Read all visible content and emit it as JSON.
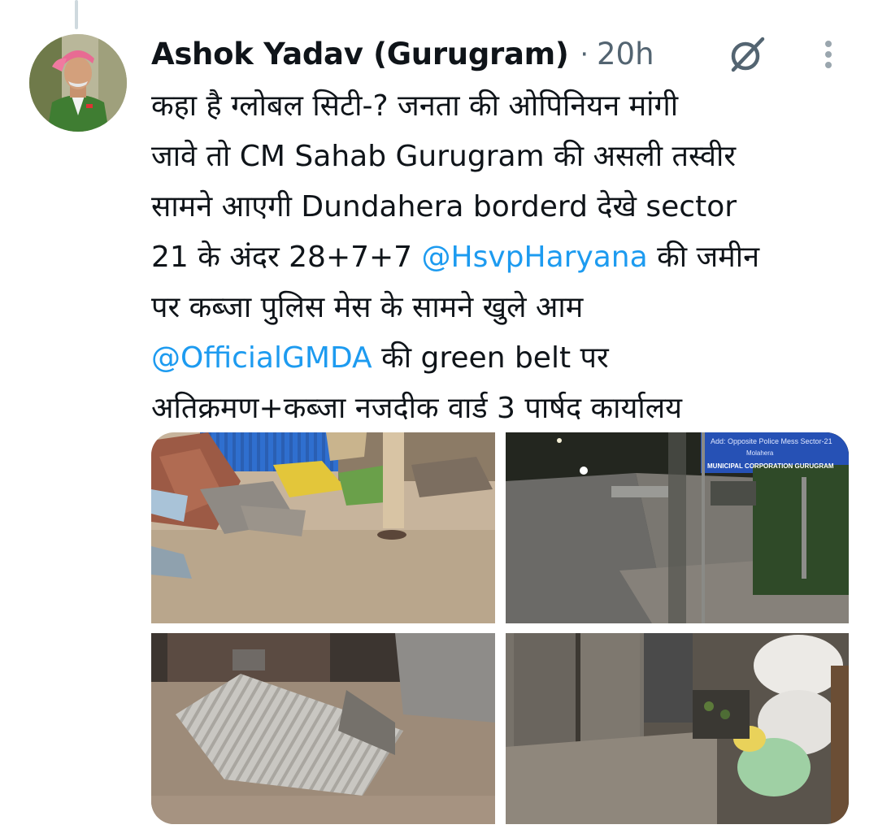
{
  "author": {
    "name": "Ashok Yadav (Gurugram)",
    "separator": "·",
    "time": "20h"
  },
  "icons": {
    "grok": "grok-icon",
    "more": "more-options-icon"
  },
  "tweet": {
    "line1": "कहा है ग्लोबल सिटी-? जनता की ओपिनियन मांगी",
    "line2": "जावे तो CM Sahab Gurugram की असली तस्वीर",
    "line3": "सामने आएगी Dundahera borderd देखे  sector",
    "line4_pre": "21 के अंदर 28+7+7 ",
    "mention1": "@HsvpHaryana",
    "line4_post": " की जमीन",
    "line5": "पर कब्जा पुलिस मेस के सामने खुले आम",
    "mention2": "@OfficialGMDA",
    "line6_post": " की green belt पर",
    "line7": "अतिक्रमण+कब्जा नजदीक वार्ड 3 पार्षद कार्यालय"
  },
  "media": {
    "sign": {
      "line1": "Add: Opposite Police Mess Sector-21",
      "line2": "Molahera",
      "line3": "MUNICIPAL CORPORATION GURUGRAM"
    }
  },
  "colors": {
    "link": "#1d9bf0",
    "text": "#0f1419",
    "secondary": "#536471"
  }
}
